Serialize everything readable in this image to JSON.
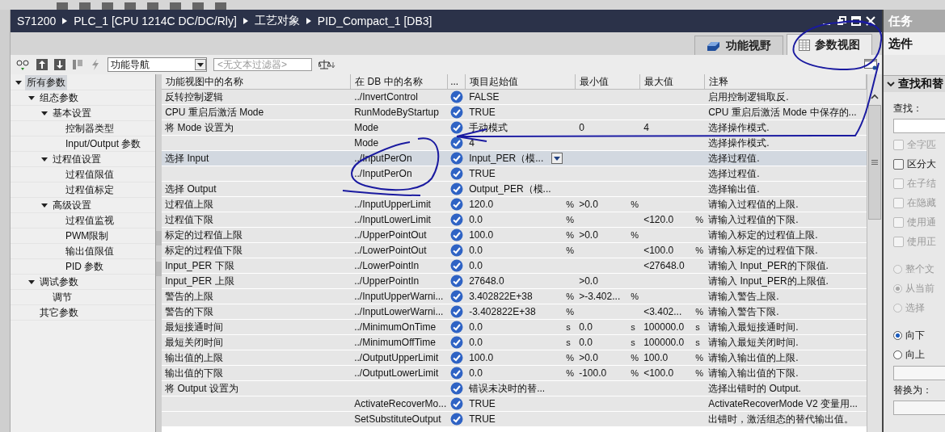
{
  "breadcrumb": [
    "S71200",
    "PLC_1 [CPU 1214C DC/DC/Rly]",
    "工艺对象",
    "PID_Compact_1 [DB3]"
  ],
  "tabs": [
    {
      "label": "功能视野",
      "selected": false
    },
    {
      "label": "参数视图",
      "selected": true
    }
  ],
  "toolbar": {
    "navigation": "功能导航",
    "filter": {
      "placeholder": "<无文本过滤器>"
    }
  },
  "tree": [
    {
      "label": "所有参数",
      "selected": true,
      "expanded": true,
      "children": [
        {
          "label": "组态参数",
          "selected": false,
          "expanded": true,
          "children": [
            {
              "label": "基本设置",
              "selected": false,
              "expanded": true,
              "children": [
                {
                  "label": "控制器类型",
                  "selected": false
                },
                {
                  "label": "Input/Output 参数",
                  "selected": false
                }
              ]
            },
            {
              "label": "过程值设置",
              "selected": false,
              "expanded": true,
              "children": [
                {
                  "label": "过程值限值",
                  "selected": false
                },
                {
                  "label": "过程值标定",
                  "selected": false
                }
              ]
            },
            {
              "label": "高级设置",
              "selected": false,
              "expanded": true,
              "children": [
                {
                  "label": "过程值监视",
                  "selected": false
                },
                {
                  "label": "PWM限制",
                  "selected": false
                },
                {
                  "label": "输出值限值",
                  "selected": false
                },
                {
                  "label": "PID 参数",
                  "selected": false
                }
              ]
            }
          ]
        },
        {
          "label": "调试参数",
          "selected": false,
          "expanded": true,
          "children": [
            {
              "label": "调节",
              "selected": false
            }
          ]
        },
        {
          "label": "其它参数",
          "selected": false
        }
      ]
    }
  ],
  "table": {
    "columns": [
      "功能视图中的名称",
      "在 DB 中的名称",
      "...",
      "项目起始值",
      "最小值",
      "最大值",
      "注释"
    ],
    "rows": [
      {
        "name": "反转控制逻辑",
        "db": "../InvertControl",
        "checked": true,
        "selected": false,
        "value": "FALSE",
        "comment": "启用控制逻辑取反."
      },
      {
        "name": "CPU 重启后激活 Mode",
        "db": "RunModeByStartup",
        "checked": true,
        "selected": false,
        "value": "TRUE",
        "comment": "CPU 重启后激活 Mode 中保存的..."
      },
      {
        "name": "将 Mode 设置为",
        "db": "Mode",
        "checked": true,
        "selected": false,
        "value": "手动模式",
        "min": "0",
        "max": "4",
        "comment": "选择操作模式."
      },
      {
        "db": "Mode",
        "checked": true,
        "selected": false,
        "value": "4",
        "comment": "选择操作模式."
      },
      {
        "name": "选择 Input",
        "db": "../InputPerOn",
        "checked": true,
        "selected": true,
        "value": "Input_PER（模...",
        "dropdown": true,
        "comment": "选择过程值."
      },
      {
        "db": "../InputPerOn",
        "checked": true,
        "selected": false,
        "value": "TRUE",
        "comment": "选择过程值."
      },
      {
        "name": "选择 Output",
        "checked": true,
        "selected": false,
        "value": "Output_PER（模...",
        "comment": "选择输出值."
      },
      {
        "name": "过程值上限",
        "db": "../InputUpperLimit",
        "checked": true,
        "selected": false,
        "value": "120.0",
        "value_unit": "%",
        "min": ">0.0",
        "min_unit": "%",
        "comment": "请输入过程值的上限."
      },
      {
        "name": "过程值下限",
        "db": "../InputLowerLimit",
        "checked": true,
        "selected": false,
        "value": "0.0",
        "value_unit": "%",
        "max": "<120.0",
        "max_unit": "%",
        "comment": "请输入过程值的下限."
      },
      {
        "name": "标定的过程值上限",
        "db": "../UpperPointOut",
        "checked": true,
        "selected": false,
        "value": "100.0",
        "value_unit": "%",
        "min": ">0.0",
        "min_unit": "%",
        "comment": "请输入标定的过程值上限."
      },
      {
        "name": "标定的过程值下限",
        "db": "../LowerPointOut",
        "checked": true,
        "selected": false,
        "value": "0.0",
        "value_unit": "%",
        "max": "<100.0",
        "max_unit": "%",
        "comment": "请输入标定的过程值下限."
      },
      {
        "name": "Input_PER 下限",
        "db": "../LowerPointIn",
        "checked": true,
        "selected": false,
        "value": "0.0",
        "max": "<27648.0",
        "comment": "请输入 Input_PER的下限值."
      },
      {
        "name": "Input_PER 上限",
        "db": "../UpperPointIn",
        "checked": true,
        "selected": false,
        "value": "27648.0",
        "min": ">0.0",
        "comment": "请输入 Input_PER的上限值."
      },
      {
        "name": "警告的上限",
        "db": "../InputUpperWarni...",
        "checked": true,
        "selected": false,
        "value": "3.402822E+38",
        "value_unit": "%",
        "min": ">-3.402...",
        "min_unit": "%",
        "comment": "请输入警告上限."
      },
      {
        "name": "警告的下限",
        "db": "../InputLowerWarni...",
        "checked": true,
        "selected": false,
        "value": "-3.402822E+38",
        "value_unit": "%",
        "max": "<3.402...",
        "max_unit": "%",
        "comment": "请输入警告下限."
      },
      {
        "name": "最短接通时间",
        "db": "../MinimumOnTime",
        "checked": true,
        "selected": false,
        "value": "0.0",
        "value_unit": "s",
        "min": "0.0",
        "min_unit": "s",
        "max": "100000.0",
        "max_unit": "s",
        "comment": "请输入最短接通时间."
      },
      {
        "name": "最短关闭时间",
        "db": "../MinimumOffTime",
        "checked": true,
        "selected": false,
        "value": "0.0",
        "value_unit": "s",
        "min": "0.0",
        "min_unit": "s",
        "max": "100000.0",
        "max_unit": "s",
        "comment": "请输入最短关闭时间."
      },
      {
        "name": "输出值的上限",
        "db": "../OutputUpperLimit",
        "checked": true,
        "selected": false,
        "value": "100.0",
        "value_unit": "%",
        "min": ">0.0",
        "min_unit": "%",
        "max": "100.0",
        "max_unit": "%",
        "comment": "请输入输出值的上限."
      },
      {
        "name": "输出值的下限",
        "db": "../OutputLowerLimit",
        "checked": true,
        "selected": false,
        "value": "0.0",
        "value_unit": "%",
        "min": "-100.0",
        "min_unit": "%",
        "max": "<100.0",
        "max_unit": "%",
        "comment": "请输入输出值的下限."
      },
      {
        "name": "将 Output 设置为",
        "checked": true,
        "selected": false,
        "value": "错误未决时的替...",
        "comment": "选择出错时的 Output."
      },
      {
        "db": "ActivateRecoverMo...",
        "checked": true,
        "selected": false,
        "value": "TRUE",
        "comment": "ActivateRecoverMode V2 变量用..."
      },
      {
        "db": "SetSubstituteOutput",
        "checked": true,
        "selected": false,
        "value": "TRUE",
        "comment": "出错时，激活组态的替代输出值。"
      }
    ]
  },
  "task_panel": {
    "title": "任务",
    "options": "选件",
    "section": "查找和替",
    "find_label": "查找：",
    "checkboxes": [
      {
        "label": "全字匹",
        "checked": false,
        "disabled": true
      },
      {
        "label": "区分大",
        "checked": false,
        "disabled": false
      },
      {
        "label": "在子结",
        "checked": false,
        "disabled": true
      },
      {
        "label": "在隐藏",
        "checked": false,
        "disabled": true
      },
      {
        "label": "使用通",
        "checked": false,
        "disabled": true
      },
      {
        "label": "使用正",
        "checked": false,
        "disabled": true
      }
    ],
    "scope": [
      {
        "label": "整个文",
        "selected": false,
        "disabled": true
      },
      {
        "label": "从当前",
        "selected": true,
        "disabled": true
      },
      {
        "label": "选择",
        "selected": false,
        "disabled": true
      }
    ],
    "direction": [
      {
        "label": "向下",
        "selected": true,
        "disabled": false
      },
      {
        "label": "向上",
        "selected": false,
        "disabled": false
      }
    ],
    "replace_label": "替换为："
  }
}
